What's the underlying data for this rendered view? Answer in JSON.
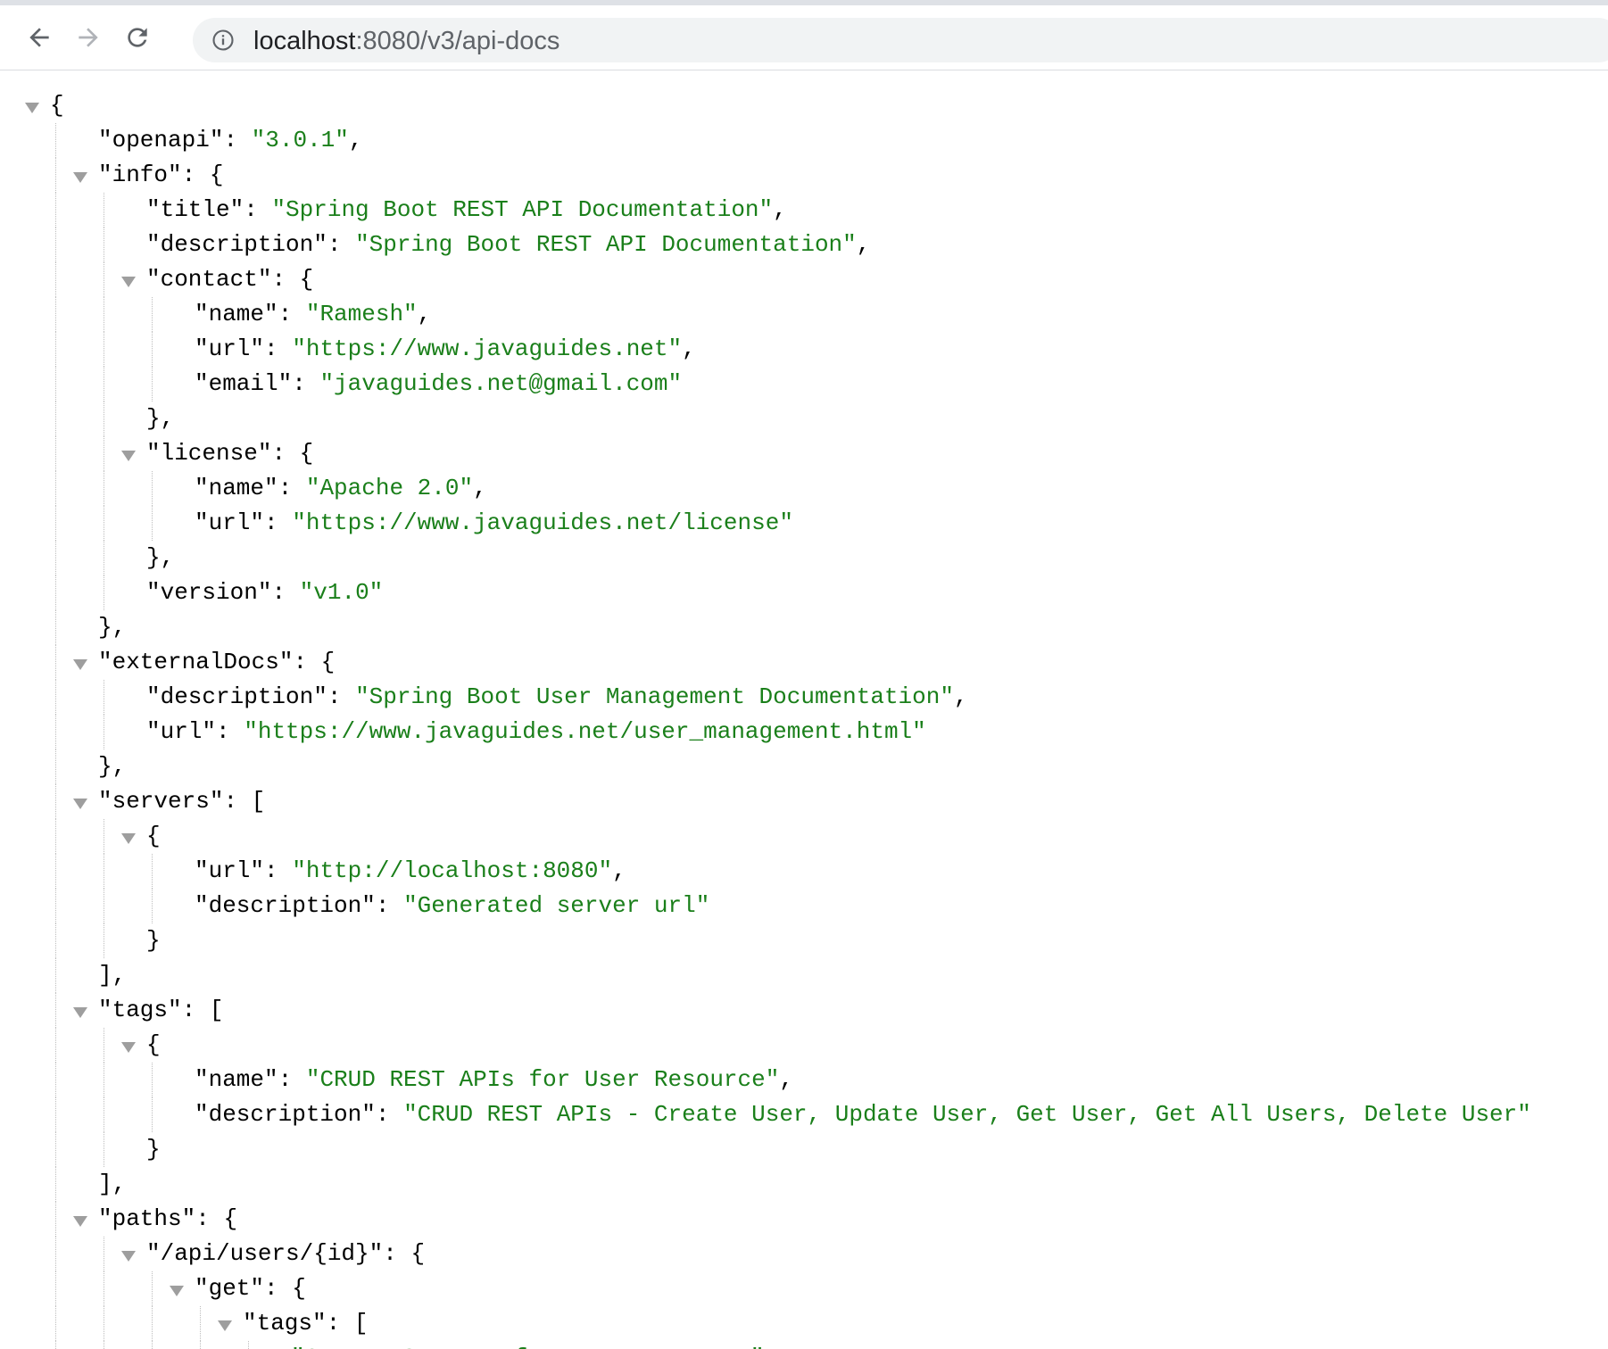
{
  "browser": {
    "url_host": "localhost",
    "url_path": ":8080/v3/api-docs",
    "icons": [
      "back-arrow-icon",
      "forward-arrow-icon",
      "reload-icon",
      "info-icon"
    ]
  },
  "colors": {
    "string": "#1a7f1a",
    "key": "#000000",
    "triangle": "#9e9e9e"
  },
  "json_lines": [
    {
      "d": 0,
      "t": 1,
      "k": "",
      "v": "",
      "p": "{"
    },
    {
      "d": 1,
      "t": 0,
      "k": "\"openapi\"",
      "v": "\"3.0.1\"",
      "p": ","
    },
    {
      "d": 1,
      "t": 1,
      "k": "\"info\"",
      "v": "",
      "p": "{"
    },
    {
      "d": 2,
      "t": 0,
      "k": "\"title\"",
      "v": "\"Spring Boot REST API Documentation\"",
      "p": ","
    },
    {
      "d": 2,
      "t": 0,
      "k": "\"description\"",
      "v": "\"Spring Boot REST API Documentation\"",
      "p": ","
    },
    {
      "d": 2,
      "t": 1,
      "k": "\"contact\"",
      "v": "",
      "p": "{"
    },
    {
      "d": 3,
      "t": 0,
      "k": "\"name\"",
      "v": "\"Ramesh\"",
      "p": ","
    },
    {
      "d": 3,
      "t": 0,
      "k": "\"url\"",
      "v": "\"https://www.javaguides.net\"",
      "p": ","
    },
    {
      "d": 3,
      "t": 0,
      "k": "\"email\"",
      "v": "\"javaguides.net@gmail.com\"",
      "p": ""
    },
    {
      "d": 2,
      "t": 0,
      "k": "",
      "v": "",
      "p": "},"
    },
    {
      "d": 2,
      "t": 1,
      "k": "\"license\"",
      "v": "",
      "p": "{"
    },
    {
      "d": 3,
      "t": 0,
      "k": "\"name\"",
      "v": "\"Apache 2.0\"",
      "p": ","
    },
    {
      "d": 3,
      "t": 0,
      "k": "\"url\"",
      "v": "\"https://www.javaguides.net/license\"",
      "p": ""
    },
    {
      "d": 2,
      "t": 0,
      "k": "",
      "v": "",
      "p": "},"
    },
    {
      "d": 2,
      "t": 0,
      "k": "\"version\"",
      "v": "\"v1.0\"",
      "p": ""
    },
    {
      "d": 1,
      "t": 0,
      "k": "",
      "v": "",
      "p": "},"
    },
    {
      "d": 1,
      "t": 1,
      "k": "\"externalDocs\"",
      "v": "",
      "p": "{"
    },
    {
      "d": 2,
      "t": 0,
      "k": "\"description\"",
      "v": "\"Spring Boot User Management Documentation\"",
      "p": ","
    },
    {
      "d": 2,
      "t": 0,
      "k": "\"url\"",
      "v": "\"https://www.javaguides.net/user_management.html\"",
      "p": ""
    },
    {
      "d": 1,
      "t": 0,
      "k": "",
      "v": "",
      "p": "},"
    },
    {
      "d": 1,
      "t": 1,
      "k": "\"servers\"",
      "v": "",
      "p": "["
    },
    {
      "d": 2,
      "t": 1,
      "k": "",
      "v": "",
      "p": "{"
    },
    {
      "d": 3,
      "t": 0,
      "k": "\"url\"",
      "v": "\"http://localhost:8080\"",
      "p": ","
    },
    {
      "d": 3,
      "t": 0,
      "k": "\"description\"",
      "v": "\"Generated server url\"",
      "p": ""
    },
    {
      "d": 2,
      "t": 0,
      "k": "",
      "v": "",
      "p": "}"
    },
    {
      "d": 1,
      "t": 0,
      "k": "",
      "v": "",
      "p": "],"
    },
    {
      "d": 1,
      "t": 1,
      "k": "\"tags\"",
      "v": "",
      "p": "["
    },
    {
      "d": 2,
      "t": 1,
      "k": "",
      "v": "",
      "p": "{"
    },
    {
      "d": 3,
      "t": 0,
      "k": "\"name\"",
      "v": "\"CRUD REST APIs for User Resource\"",
      "p": ","
    },
    {
      "d": 3,
      "t": 0,
      "k": "\"description\"",
      "v": "\"CRUD REST APIs - Create User, Update User, Get User, Get All Users, Delete User\"",
      "p": ""
    },
    {
      "d": 2,
      "t": 0,
      "k": "",
      "v": "",
      "p": "}"
    },
    {
      "d": 1,
      "t": 0,
      "k": "",
      "v": "",
      "p": "],"
    },
    {
      "d": 1,
      "t": 1,
      "k": "\"paths\"",
      "v": "",
      "p": "{"
    },
    {
      "d": 2,
      "t": 1,
      "k": "\"/api/users/{id}\"",
      "v": "",
      "p": "{"
    },
    {
      "d": 3,
      "t": 1,
      "k": "\"get\"",
      "v": "",
      "p": "{"
    },
    {
      "d": 4,
      "t": 1,
      "k": "\"tags\"",
      "v": "",
      "p": "["
    },
    {
      "d": 5,
      "t": 0,
      "k": "",
      "v": "\"CRUD REST APIs for User Resource\"",
      "p": ""
    }
  ]
}
